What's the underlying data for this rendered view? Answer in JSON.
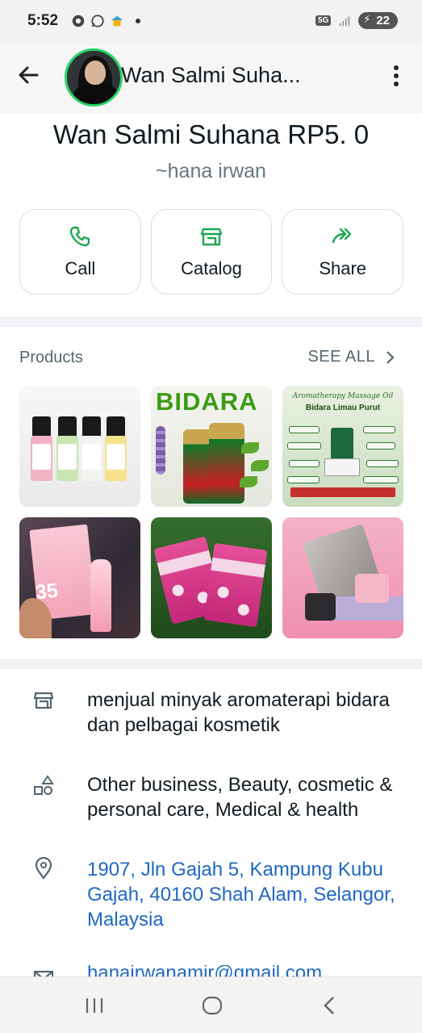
{
  "status_bar": {
    "time": "5:52",
    "network_label": "5G",
    "battery": "22"
  },
  "header": {
    "title": "Wan Salmi Suha..."
  },
  "profile": {
    "name": "Wan Salmi Suhana RP5. 0",
    "push_name": "~hana irwan"
  },
  "actions": [
    {
      "label": "Call",
      "icon": "phone-icon"
    },
    {
      "label": "Catalog",
      "icon": "storefront-icon"
    },
    {
      "label": "Share",
      "icon": "forward-icon"
    }
  ],
  "products": {
    "title": "Products",
    "see_all": "SEE ALL",
    "tile_texts": {
      "bidara": "BIDARA",
      "poster_header": "Aromatherapy Massage Oil",
      "poster_subheader": "Bidara Limau Purut",
      "spf": "35"
    }
  },
  "info": {
    "description": "menjual minyak aromaterapi bidara dan pelbagai kosmetik",
    "category": "Other business, Beauty, cosmetic & personal care, Medical & health",
    "address": "1907, Jln Gajah 5, Kampung Kubu Gajah, 40160 Shah Alam, Selangor, Malaysia",
    "email": "hanairwanamir@gmail.com"
  },
  "colors": {
    "accent_green": "#1fa855",
    "link_blue": "#1f67c2",
    "avatar_ring": "#25d366"
  }
}
